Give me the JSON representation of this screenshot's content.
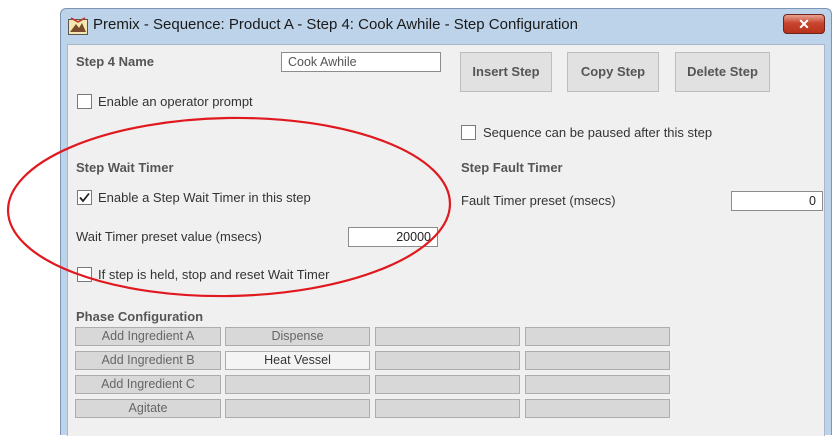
{
  "window": {
    "title": "Premix - Sequence: Product A - Step 4: Cook Awhile - Step Configuration",
    "close_label": "✕"
  },
  "step": {
    "name_label": "Step 4 Name",
    "name_value": "Cook Awhile",
    "operator_prompt_label": "Enable an operator prompt",
    "operator_prompt_checked": false,
    "pause_label": "Sequence can be paused after this step",
    "pause_checked": false
  },
  "toolbar": {
    "insert_label": "Insert Step",
    "copy_label": "Copy Step",
    "delete_label": "Delete Step"
  },
  "wait_timer": {
    "header": "Step Wait Timer",
    "enable_label": "Enable a Step Wait Timer in this step",
    "enable_checked": true,
    "preset_label": "Wait Timer preset value (msecs)",
    "preset_value": "20000",
    "reset_label": "If step is held, stop and reset Wait Timer",
    "reset_checked": false
  },
  "fault_timer": {
    "header": "Step Fault Timer",
    "preset_label": "Fault Timer preset (msecs)",
    "preset_value": "0"
  },
  "phase_config": {
    "header": "Phase Configuration",
    "rows": [
      {
        "phase": "Add Ingredient A",
        "cells": [
          "Dispense",
          "",
          ""
        ]
      },
      {
        "phase": "Add Ingredient B",
        "cells": [
          "Heat Vessel",
          "",
          ""
        ]
      },
      {
        "phase": "Add Ingredient C",
        "cells": [
          "",
          "",
          ""
        ]
      },
      {
        "phase": "Agitate",
        "cells": [
          "",
          "",
          ""
        ]
      }
    ]
  },
  "colors": {
    "annotation": "#e0191f",
    "titlebar": "#bcd3ea",
    "close_button": "#c7452e"
  }
}
